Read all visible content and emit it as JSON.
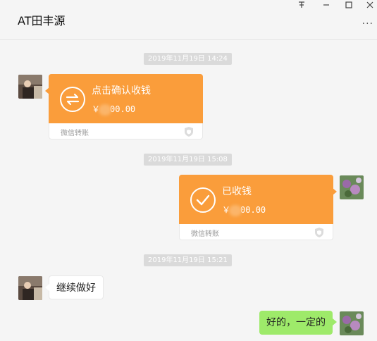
{
  "header": {
    "title": "AT田丰源",
    "pin_icon": "pin-icon",
    "minimize_icon": "minimize-icon",
    "maximize_icon": "maximize-icon",
    "close_icon": "close-icon",
    "more_label": "···"
  },
  "messages": {
    "t1": "2019年11月19日 14:24",
    "transfer1": {
      "title": "点击确认收钱",
      "currency": "￥",
      "amount_visible": "00.00",
      "footer": "微信转账",
      "icon": "transfer-arrows-icon"
    },
    "t2": "2019年11月19日 15:08",
    "transfer2": {
      "title": "已收钱",
      "currency": "￥",
      "amount_visible": "00.00",
      "footer": "微信转账",
      "icon": "checkmark-icon"
    },
    "t3": "2019年11月19日 15:21",
    "text1": "继续做好",
    "text2": "好的，一定的"
  },
  "colors": {
    "transfer_orange": "#fa9d3b",
    "self_bubble_green": "#9eea6a",
    "background": "#f5f5f5",
    "timestamp_bg": "#dadada"
  }
}
